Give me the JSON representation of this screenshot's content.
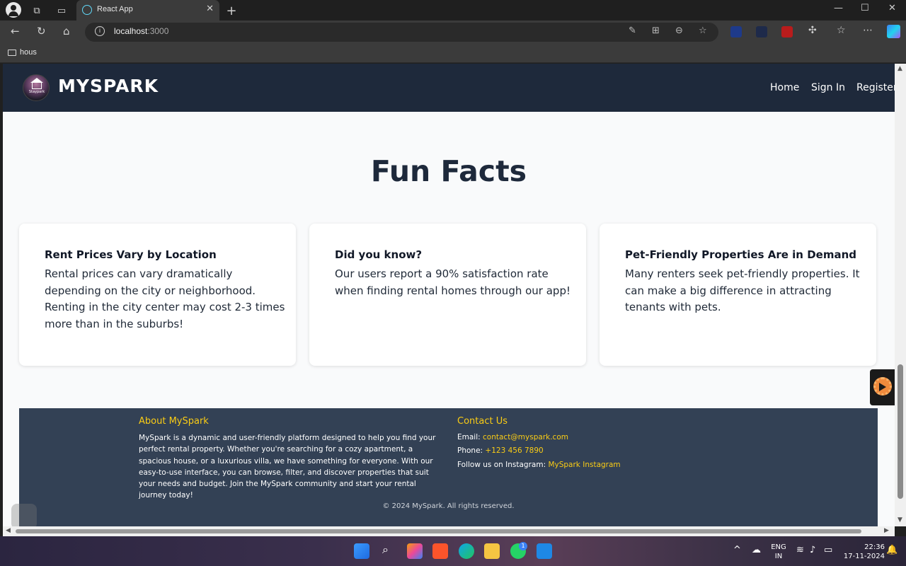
{
  "browser": {
    "tab_title": "React App",
    "address_host": "localhost",
    "address_port": ":3000",
    "bookmark_folder": "hous"
  },
  "nav": {
    "brand": "MYSPARK",
    "logo_text": "Staypark",
    "links": [
      "Home",
      "Sign In",
      "Register"
    ]
  },
  "main": {
    "heading": "Fun Facts",
    "cards": [
      {
        "title": "Rent Prices Vary by Location",
        "text": "Rental prices can vary dramatically depending on the city or neighborhood. Renting in the city center may cost 2-3 times more than in the suburbs!"
      },
      {
        "title": "Did you know?",
        "text": "Our users report a 90% satisfaction rate when finding rental homes through  our app!"
      },
      {
        "title": "Pet-Friendly Properties Are in Demand",
        "text": "Many renters seek pet-friendly properties. It can make a big difference in attracting tenants with pets."
      }
    ]
  },
  "footer": {
    "about_heading": "About MySpark",
    "about_text": "MySpark is a dynamic and user-friendly platform designed to help you find your perfect rental property. Whether you're searching for a cozy apartment, a spacious house, or a luxurious villa, we have something for everyone. With our easy-to-use interface, you can browse, filter, and discover properties that suit your needs and budget. Join the MySpark community and start your rental journey today!",
    "contact_heading": "Contact Us",
    "email_label": "Email: ",
    "email": "contact@myspark.com",
    "phone_label": "Phone: ",
    "phone": "+123 456 7890",
    "instagram_label": "Follow us on Instagram: ",
    "instagram": "MySpark Instagram",
    "copyright": "© 2024 MySpark. All rights reserved."
  },
  "taskbar": {
    "lang": "ENG",
    "region": "IN",
    "time": "22:36",
    "date": "17-11-2024",
    "whatsapp_badge": "1"
  },
  "colors": {
    "header_bg": "#1e293b",
    "footer_bg": "#334155",
    "accent": "#facc15",
    "page_bg": "#f9fafb"
  }
}
